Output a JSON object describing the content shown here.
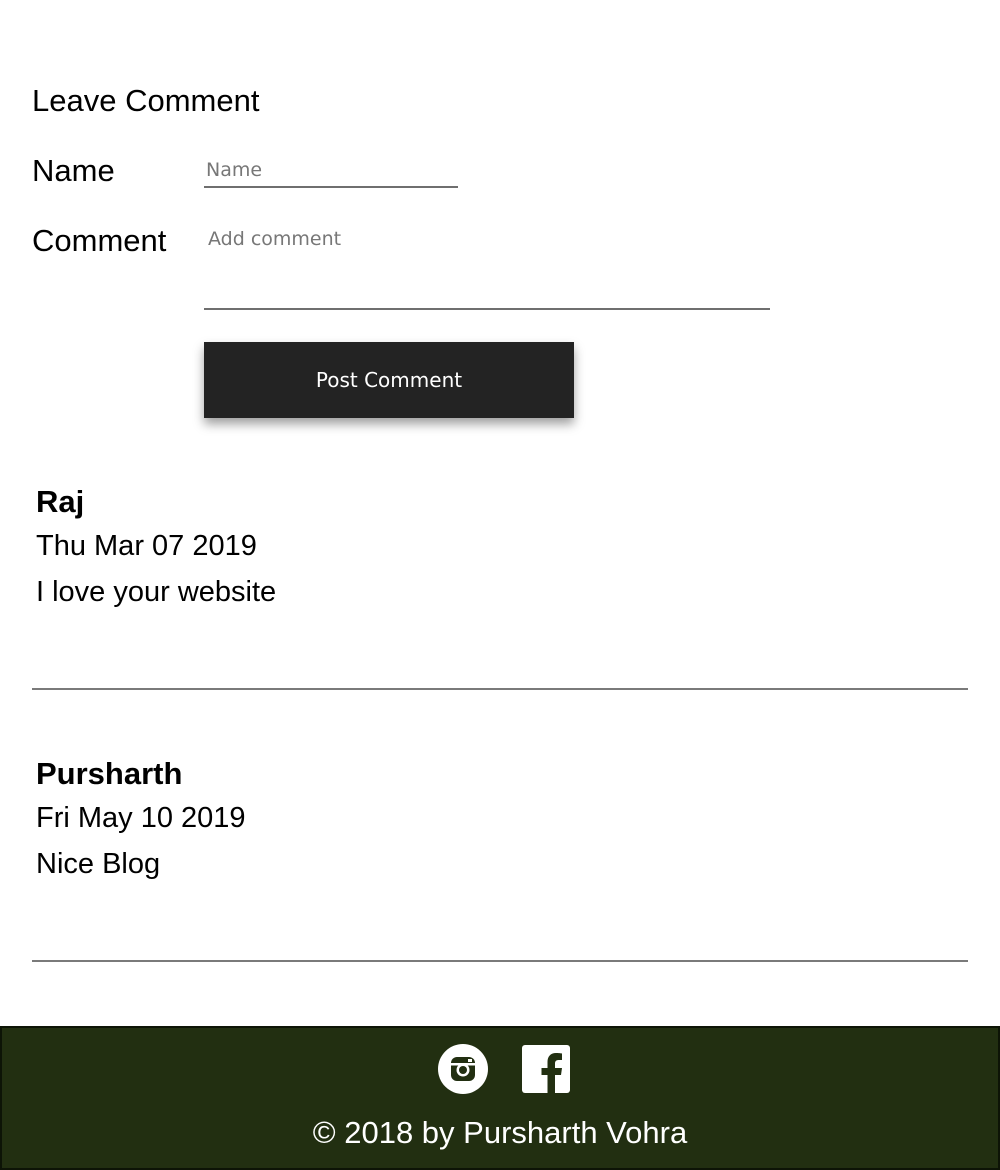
{
  "comment_form": {
    "heading": "Leave Comment",
    "name_label": "Name",
    "name_placeholder": "Name",
    "name_value": "",
    "comment_label": "Comment",
    "comment_placeholder": "Add comment",
    "comment_value": "",
    "submit_label": "Post Comment"
  },
  "comments": [
    {
      "author": "Raj",
      "date": "Thu Mar 07 2019",
      "text": "I love your website"
    },
    {
      "author": "Pursharth",
      "date": "Fri May 10 2019",
      "text": "Nice Blog"
    }
  ],
  "footer": {
    "background_color": "#222f11",
    "social_icons": [
      "instagram-icon",
      "facebook-icon"
    ],
    "copyright": "© 2018 by Pursharth Vohra"
  },
  "colors": {
    "button_background": "#232323",
    "button_text": "#ffffff",
    "divider": "#7a7a7a"
  }
}
